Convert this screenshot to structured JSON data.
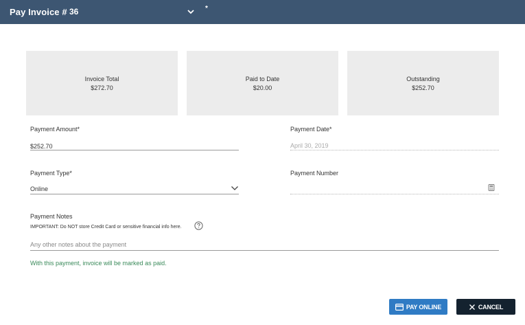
{
  "header": {
    "title": "Pay Invoice #",
    "invoice_number": "36",
    "marker": "*"
  },
  "summary": [
    {
      "label": "Invoice Total",
      "value": "$272.70"
    },
    {
      "label": "Paid to Date",
      "value": "$20.00"
    },
    {
      "label": "Outstanding",
      "value": "$252.70"
    }
  ],
  "form": {
    "payment_amount": {
      "label": "Payment Amount*",
      "value": "$252.70"
    },
    "payment_date": {
      "label": "Payment Date*",
      "value": "April 30, 2019"
    },
    "payment_type": {
      "label": "Payment Type*",
      "value": "Online"
    },
    "payment_number": {
      "label": "Payment Number",
      "value": ""
    },
    "payment_notes": {
      "label": "Payment Notes",
      "warning": "IMPORTANT: Do NOT store Credit Card or sensitive financial info here.",
      "placeholder": "Any other notes about the payment"
    },
    "status_message": "With this payment, invoice will be marked as paid."
  },
  "actions": {
    "pay_online": "PAY ONLINE",
    "cancel": "CANCEL"
  },
  "colors": {
    "header_bg": "#3d5672",
    "primary_button": "#2f7bc4",
    "cancel_button": "#14222f",
    "success_text": "#3a8a5a"
  }
}
